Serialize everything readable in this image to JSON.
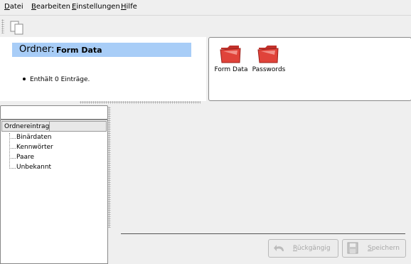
{
  "menubar": {
    "items": [
      {
        "ul": "D",
        "rest": "atei"
      },
      {
        "ul": "B",
        "rest": "earbeiten"
      },
      {
        "ul": "E",
        "rest": "instellungen"
      },
      {
        "ul": "H",
        "rest": "ilfe"
      }
    ]
  },
  "folder": {
    "label": "Ordner:",
    "name": "Form Data",
    "info": "Enthält 0 Einträge."
  },
  "folder_items": [
    "Form Data",
    "Passwords"
  ],
  "tree": {
    "column": "Ordnereintrag",
    "items": [
      "Binärdaten",
      "Kennwörter",
      "Paare",
      "Unbekannt"
    ]
  },
  "buttons": {
    "undo": {
      "ul": "R",
      "rest": "ückgängig"
    },
    "save": {
      "ul": "S",
      "rest": "peichern"
    }
  },
  "colors": {
    "banner": "#a8cdf7",
    "folder_red": "#e0433a"
  }
}
